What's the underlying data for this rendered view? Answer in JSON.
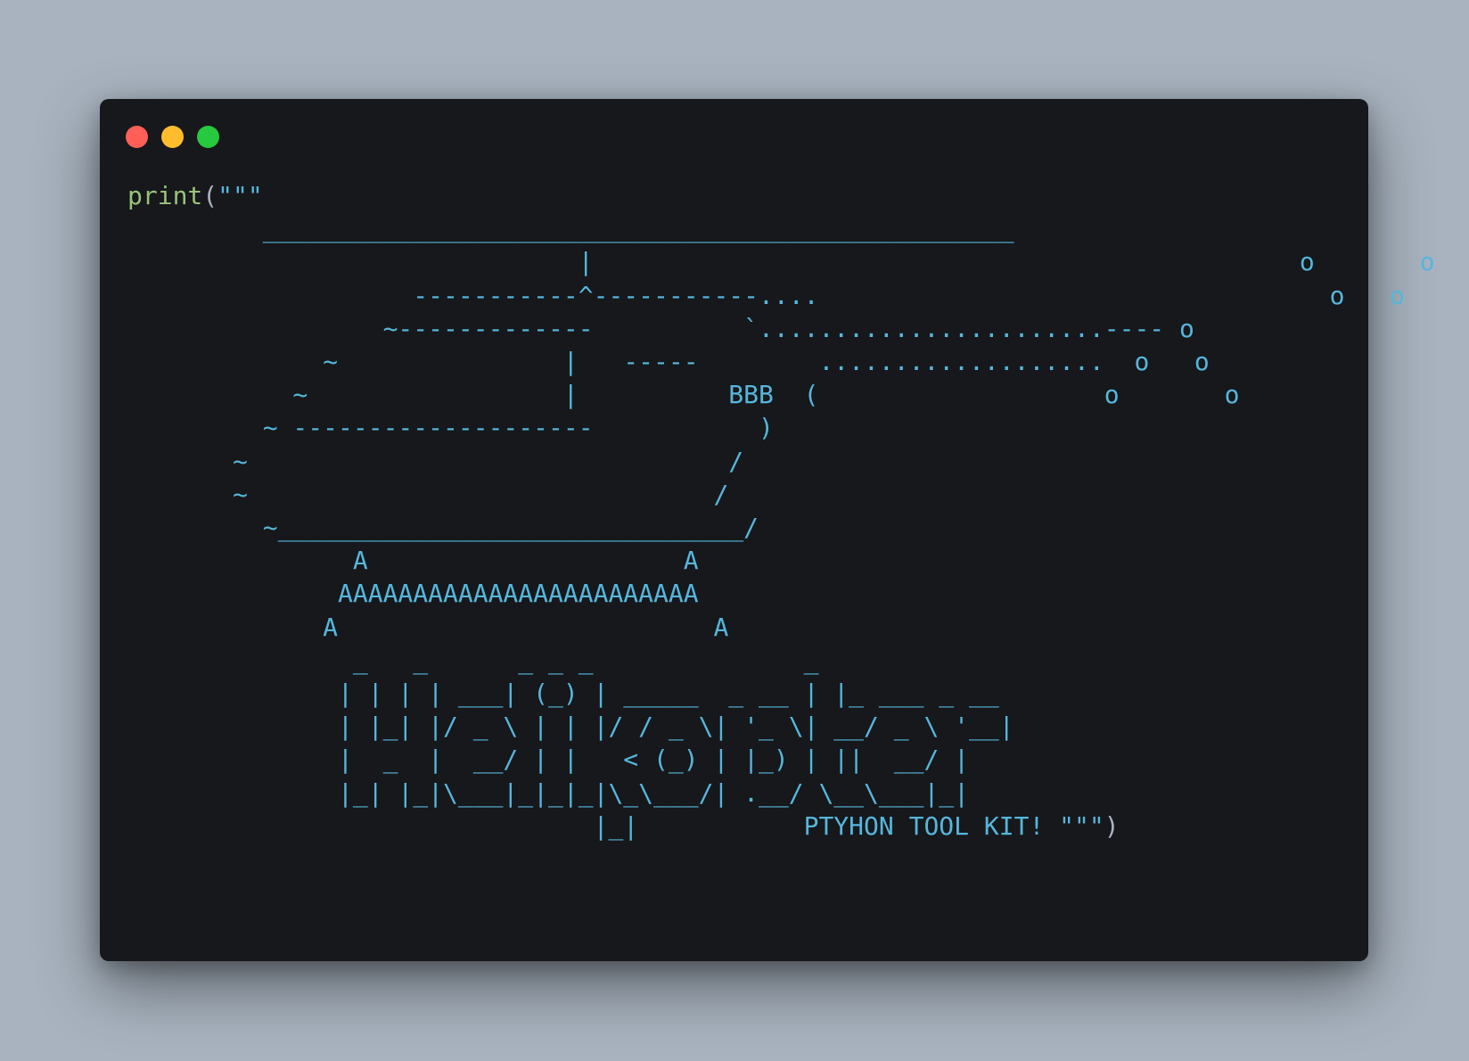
{
  "window": {
    "controls": {
      "close_color": "#ff5f56",
      "minimize_color": "#ffbd2e",
      "maximize_color": "#27c93f"
    }
  },
  "code": {
    "function_name": "print",
    "open_paren": "(",
    "close_paren": ")",
    "ascii_art": "\"\"\"\n         __________________________________________________                 \n                              |                                               o       o\n                   -----------^-----------....                                  o   o\n                 ~-------------          `.......................---- o\n             ~               |   -----        ...................  o   o\n           ~                 |          BBB  (                   o       o\n         ~ --------------------           )\n       ~                                /\n       ~                               /\n         ~_______________________________/\n               A                     A\n              AAAAAAAAAAAAAAAAAAAAAAAA\n             A                         A\n               _   _      _ _ _              _\n              | | | | ___| (_) | _____  _ __ | |_ ___ _ __\n              | |_| |/ _ \\ | | |/ / _ \\| '_ \\| __/ _ \\ '__|\n              |  _  |  __/ | |   < (_) | |_) | ||  __/ |\n              |_| |_|\\___|_|_|_|\\_\\___/| .__/ \\__\\___|_|\n                               |_|           PTYHON TOOL KIT! \"\"\""
  }
}
